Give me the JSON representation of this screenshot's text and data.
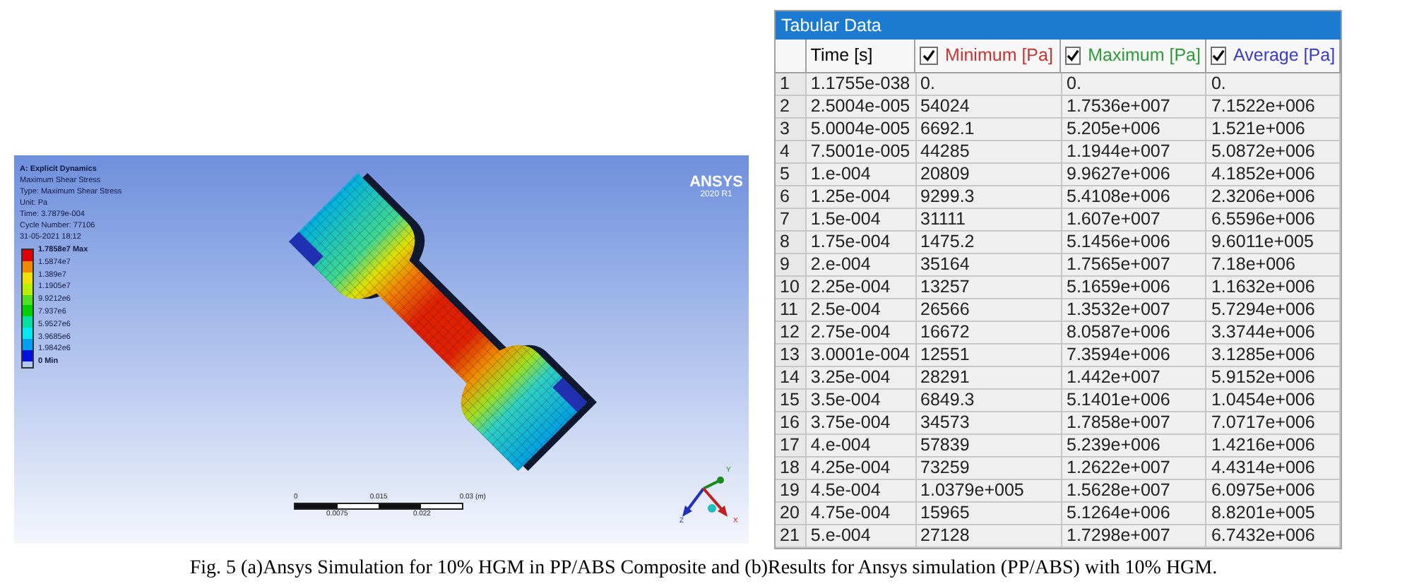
{
  "panel_a": {
    "title": "A: Explicit Dynamics",
    "info_lines": [
      "Maximum Shear Stress",
      "Type: Maximum Shear Stress",
      "Unit: Pa",
      "Time: 3.7879e-004",
      "Cycle Number: 77106",
      "31-05-2021 18:12"
    ],
    "legend": {
      "bands": [
        {
          "color": "#e00000"
        },
        {
          "color": "#f08a00"
        },
        {
          "color": "#f0e000"
        },
        {
          "color": "#b8f000"
        },
        {
          "color": "#50e020"
        },
        {
          "color": "#00d000"
        },
        {
          "color": "#00e0a0"
        },
        {
          "color": "#00e8f0"
        },
        {
          "color": "#00a0f0"
        },
        {
          "color": "#0010e0"
        }
      ],
      "labels": [
        {
          "text": "1.7858e7 Max",
          "kind": "max"
        },
        {
          "text": "1.5874e7",
          "kind": "value"
        },
        {
          "text": "1.389e7",
          "kind": "value"
        },
        {
          "text": "1.1905e7",
          "kind": "value"
        },
        {
          "text": "9.9212e6",
          "kind": "value"
        },
        {
          "text": "7.937e6",
          "kind": "value"
        },
        {
          "text": "5.9527e6",
          "kind": "value"
        },
        {
          "text": "3.9685e6",
          "kind": "value"
        },
        {
          "text": "1.9842e6",
          "kind": "value"
        },
        {
          "text": "0 Min",
          "kind": "min"
        }
      ]
    },
    "logo": {
      "name": "ANSYS",
      "version": "2020 R1"
    },
    "scale_bar": {
      "top_labels": [
        "0",
        "0.015",
        "0.03 (m)"
      ],
      "bottom_labels": [
        "0.0075",
        "0.022"
      ]
    },
    "triad": [
      {
        "label": "Y",
        "color": "#1a8a1a"
      },
      {
        "label": "Z",
        "color": "#2030c0"
      },
      {
        "label": "X",
        "color": "#c02020"
      }
    ]
  },
  "panel_b": {
    "title": "Tabular Data",
    "columns": [
      {
        "kind": "corner"
      },
      {
        "label": "Time [s]",
        "kind": "plain",
        "color": "#000000"
      },
      {
        "label": "Minimum [Pa]",
        "kind": "checkbox",
        "checked": true,
        "color": "#c83232"
      },
      {
        "label": "Maximum [Pa]",
        "kind": "checkbox",
        "checked": true,
        "color": "#2e9a3a"
      },
      {
        "label": "Average [Pa]",
        "kind": "checkbox",
        "checked": true,
        "color": "#3a3ac8"
      }
    ],
    "rows": [
      [
        "1",
        "1.1755e-038",
        "0.",
        "0.",
        "0."
      ],
      [
        "2",
        "2.5004e-005",
        "54024",
        "1.7536e+007",
        "7.1522e+006"
      ],
      [
        "3",
        "5.0004e-005",
        "6692.1",
        "5.205e+006",
        "1.521e+006"
      ],
      [
        "4",
        "7.5001e-005",
        "44285",
        "1.1944e+007",
        "5.0872e+006"
      ],
      [
        "5",
        "1.e-004",
        "20809",
        "9.9627e+006",
        "4.1852e+006"
      ],
      [
        "6",
        "1.25e-004",
        "9299.3",
        "5.4108e+006",
        "2.3206e+006"
      ],
      [
        "7",
        "1.5e-004",
        "31111",
        "1.607e+007",
        "6.5596e+006"
      ],
      [
        "8",
        "1.75e-004",
        "1475.2",
        "5.1456e+006",
        "9.6011e+005"
      ],
      [
        "9",
        "2.e-004",
        "35164",
        "1.7565e+007",
        "7.18e+006"
      ],
      [
        "10",
        "2.25e-004",
        "13257",
        "5.1659e+006",
        "1.1632e+006"
      ],
      [
        "11",
        "2.5e-004",
        "26566",
        "1.3532e+007",
        "5.7294e+006"
      ],
      [
        "12",
        "2.75e-004",
        "16672",
        "8.0587e+006",
        "3.3744e+006"
      ],
      [
        "13",
        "3.0001e-004",
        "12551",
        "7.3594e+006",
        "3.1285e+006"
      ],
      [
        "14",
        "3.25e-004",
        "28291",
        "1.442e+007",
        "5.9152e+006"
      ],
      [
        "15",
        "3.5e-004",
        "6849.3",
        "5.1401e+006",
        "1.0454e+006"
      ],
      [
        "16",
        "3.75e-004",
        "34573",
        "1.7858e+007",
        "7.0717e+006"
      ],
      [
        "17",
        "4.e-004",
        "57839",
        "5.239e+006",
        "1.4216e+006"
      ],
      [
        "18",
        "4.25e-004",
        "73259",
        "1.2622e+007",
        "4.4314e+006"
      ],
      [
        "19",
        "4.5e-004",
        "1.0379e+005",
        "1.5628e+007",
        "6.0975e+006"
      ],
      [
        "20",
        "4.75e-004",
        "15965",
        "5.1264e+006",
        "8.8201e+005"
      ],
      [
        "21",
        "5.e-004",
        "27128",
        "1.7298e+007",
        "6.7432e+006"
      ]
    ]
  },
  "caption": "Fig. 5 (a)Ansys Simulation for 10% HGM in PP/ABS Composite and (b)Results for Ansys simulation (PP/ABS) with 10% HGM."
}
